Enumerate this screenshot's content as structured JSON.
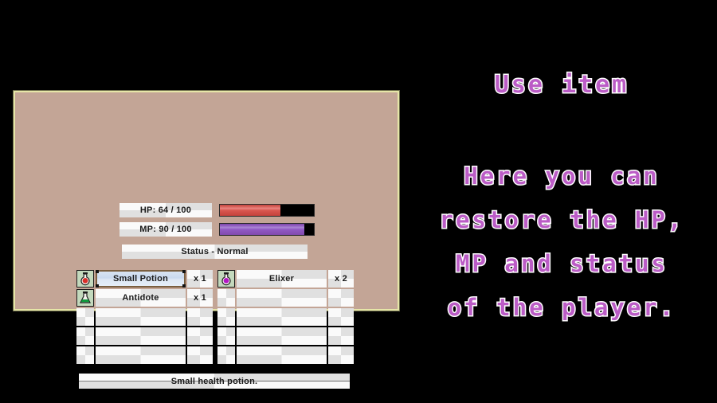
{
  "theme": {
    "panel_bg": "#c3a596",
    "panel_border": "#e6e6a8",
    "backdrop": "#000000",
    "hp_color": "#d9564f",
    "mp_color": "#9159c4",
    "caption_fill": "#bb5cc6",
    "caption_outline": "#ffffff",
    "select_border": "#7a5e3f",
    "select_fill": "#c9d9ee"
  },
  "menu": {
    "stats": {
      "hp": {
        "label": "HP: 64 / 100",
        "current": 64,
        "max": 100,
        "percent": 64
      },
      "mp": {
        "label": "MP: 90 / 100",
        "current": 90,
        "max": 100,
        "percent": 90
      },
      "status": {
        "label": "Status - Normal",
        "value": "Normal"
      }
    },
    "inventory": {
      "columns": [
        {
          "slots": [
            {
              "icon": "red-potion-icon",
              "name": "Small Potion",
              "qty": "x 1",
              "selected": true
            },
            {
              "icon": "green-flask-icon",
              "name": "Antidote",
              "qty": "x 1",
              "selected": false
            },
            {
              "icon": "",
              "name": "",
              "qty": "",
              "selected": false
            },
            {
              "icon": "",
              "name": "",
              "qty": "",
              "selected": false
            },
            {
              "icon": "",
              "name": "",
              "qty": "",
              "selected": false
            }
          ]
        },
        {
          "slots": [
            {
              "icon": "purple-potion-icon",
              "name": "Elixer",
              "qty": "x 2",
              "selected": false
            },
            {
              "icon": "",
              "name": "",
              "qty": "",
              "selected": false
            },
            {
              "icon": "",
              "name": "",
              "qty": "",
              "selected": false
            },
            {
              "icon": "",
              "name": "",
              "qty": "",
              "selected": false
            },
            {
              "icon": "",
              "name": "",
              "qty": "",
              "selected": false
            }
          ]
        }
      ]
    },
    "description": "Small health potion."
  },
  "caption": {
    "title": "Use item",
    "lines": [
      "Here you can",
      "restore the HP,",
      "MP and status",
      "of the player."
    ]
  }
}
